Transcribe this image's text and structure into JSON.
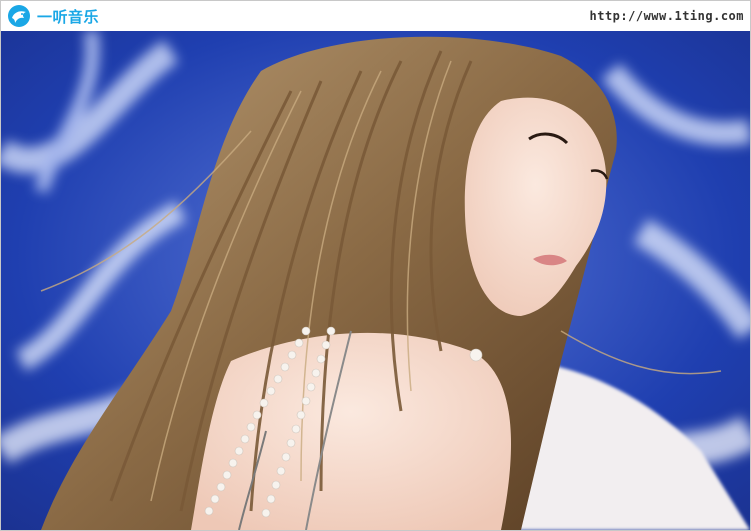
{
  "header": {
    "logo_text": "一听音乐",
    "site_url": "http://www.1ting.com"
  },
  "photo": {
    "subject": "photo-of-woman-with-long-wavy-hair"
  },
  "colors": {
    "brand": "#1aa7e6",
    "background_blue": "#1f3fb0",
    "hair": "#8a6a45"
  }
}
